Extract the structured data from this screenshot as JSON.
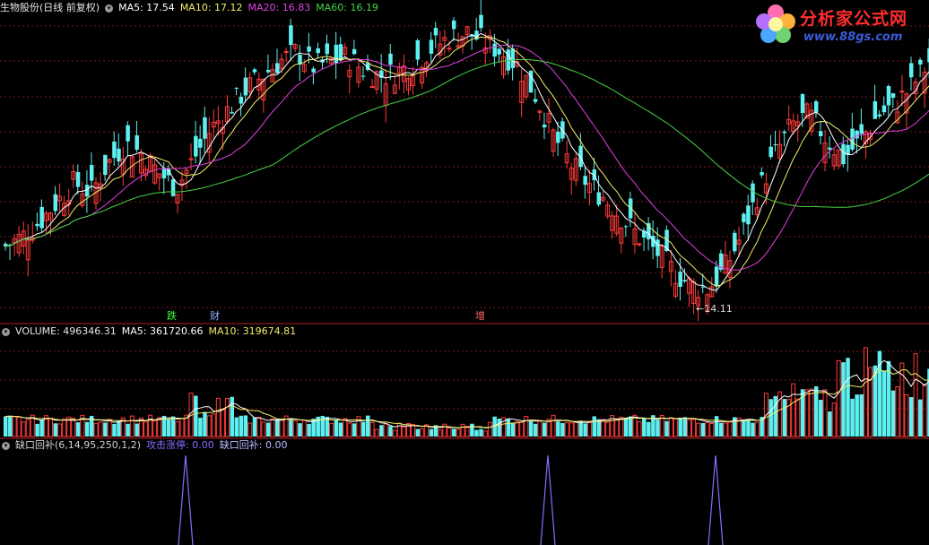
{
  "header": {
    "stock_name": "生物股份(日线 前复权)",
    "ma5_label": "MA5: 17.54",
    "ma10_label": "MA10: 17.12",
    "ma20_label": "MA20: 16.83",
    "ma60_label": "MA60: 16.19"
  },
  "volume_header": {
    "label": "VOLUME: 496346.31",
    "ma5_label": "MA5: 361720.66",
    "ma10_label": "MA10: 319674.81"
  },
  "indicator_header": {
    "name": "缺口回补(6,14,95,250,1,2)",
    "attack_label": "攻击涨停: 0.00",
    "gap_label": "缺口回补: 0.00"
  },
  "annotations": {
    "tag1": "跌",
    "tag2": "财",
    "tag3": "增",
    "low_label": "←14.11"
  },
  "logo": {
    "title": "分析家公式网",
    "url": "www.88gs.com"
  },
  "colors": {
    "up": "#ff3b3b",
    "down": "#5ef0f0",
    "ma5": "#ffffff",
    "ma10": "#f2ee6a",
    "ma20": "#e040e0",
    "ma60": "#44d444",
    "grid": "#7a1a1a",
    "indicator": "#8a6cff"
  },
  "chart_data": {
    "type": "candlestick",
    "low_marker": 14.11,
    "latest": {
      "MA5": 17.54,
      "MA10": 17.12,
      "MA20": 16.83,
      "MA60": 16.19,
      "VOLUME": 496346.31,
      "VOL_MA5": 361720.66,
      "VOL_MA10": 319674.81,
      "attack_limit_up": 0.0,
      "gap_fill": 0.0
    },
    "close_trend": [
      15.1,
      15.3,
      15.6,
      16.0,
      16.4,
      16.2,
      16.8,
      17.2,
      17.0,
      16.6,
      16.3,
      16.9,
      17.5,
      17.9,
      18.3,
      18.6,
      18.9,
      19.1,
      18.8,
      18.9,
      19.0,
      18.7,
      18.6,
      18.7,
      18.9,
      19.2,
      19.4,
      19.5,
      19.3,
      19.1,
      18.8,
      18.2,
      17.4,
      16.8,
      16.4,
      16.1,
      15.7,
      15.3,
      15.0,
      14.6,
      14.3,
      14.2,
      14.6,
      15.3,
      16.2,
      17.0,
      17.6,
      17.8,
      17.3,
      16.9,
      17.3,
      17.8,
      18.0,
      18.4,
      18.9
    ],
    "indicator_spikes_at": [
      0.2,
      0.59,
      0.77
    ]
  }
}
